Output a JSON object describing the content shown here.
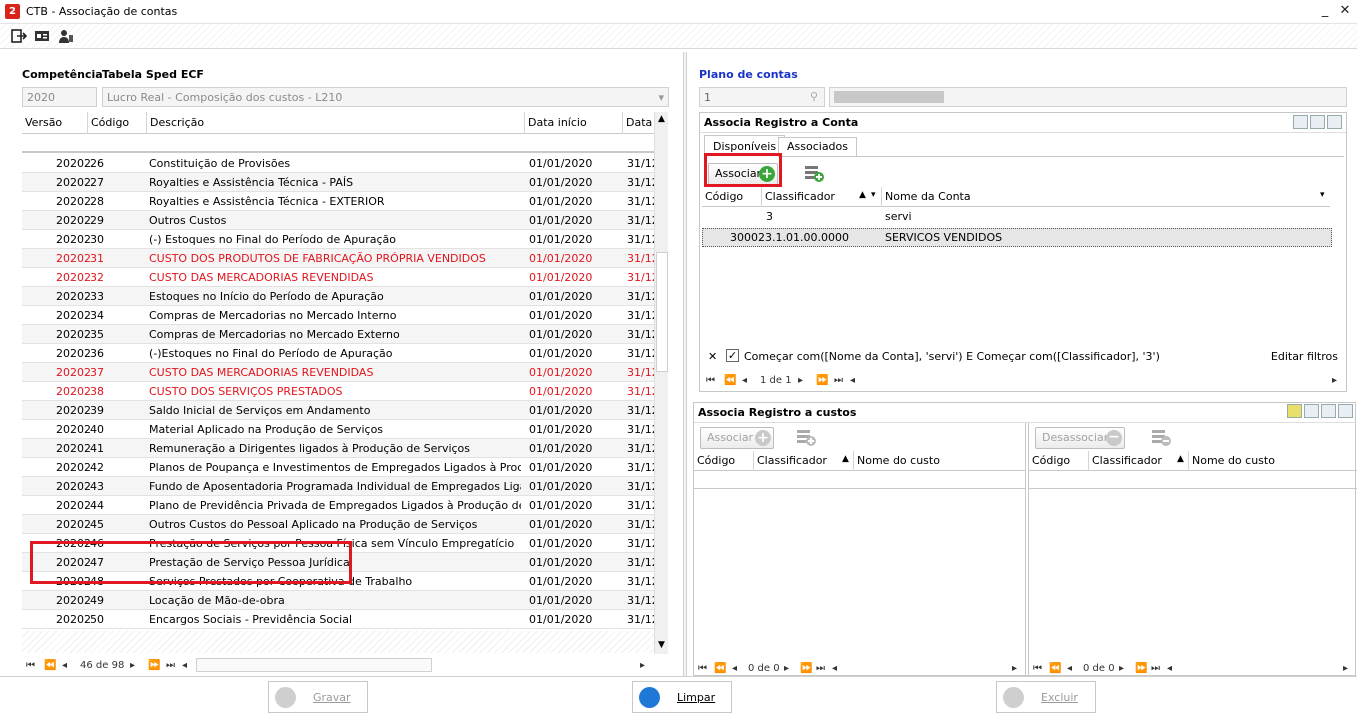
{
  "window": {
    "title": "CTB - Associação de contas",
    "minimize": "_",
    "close": "✕"
  },
  "left": {
    "competencia_label": "Competência",
    "competencia_value": "2020",
    "tabela_label": "Tabela Sped ECF",
    "tabela_value": "Lucro Real - Composição dos custos - L210",
    "columns": [
      "Versão",
      "Código",
      "Descrição",
      "Data início",
      "Data"
    ],
    "rows": [
      {
        "v": "20202",
        "c": "26",
        "d": "Constituição de Provisões",
        "di": "01/01/2020",
        "df": "31/12",
        "red": false
      },
      {
        "v": "20202",
        "c": "27",
        "d": "Royalties e Assistência Técnica - PAÍS",
        "di": "01/01/2020",
        "df": "31/12",
        "red": false
      },
      {
        "v": "20202",
        "c": "28",
        "d": "Royalties e Assistência Técnica - EXTERIOR",
        "di": "01/01/2020",
        "df": "31/12",
        "red": false
      },
      {
        "v": "20202",
        "c": "29",
        "d": "Outros Custos",
        "di": "01/01/2020",
        "df": "31/12",
        "red": false
      },
      {
        "v": "20202",
        "c": "30",
        "d": "(-) Estoques no Final do Período de Apuração",
        "di": "01/01/2020",
        "df": "31/12",
        "red": false
      },
      {
        "v": "20202",
        "c": "31",
        "d": "CUSTO DOS PRODUTOS DE FABRICAÇÃO PRÓPRIA VENDIDOS",
        "di": "01/01/2020",
        "df": "31/12",
        "red": true
      },
      {
        "v": "20202",
        "c": "32",
        "d": "CUSTO DAS MERCADORIAS REVENDIDAS",
        "di": "01/01/2020",
        "df": "31/12",
        "red": true
      },
      {
        "v": "20202",
        "c": "33",
        "d": "Estoques no Início do Período de Apuração",
        "di": "01/01/2020",
        "df": "31/12",
        "red": false
      },
      {
        "v": "20202",
        "c": "34",
        "d": "Compras de Mercadorias no Mercado Interno",
        "di": "01/01/2020",
        "df": "31/12",
        "red": false
      },
      {
        "v": "20202",
        "c": "35",
        "d": "Compras de Mercadorias no Mercado Externo",
        "di": "01/01/2020",
        "df": "31/12",
        "red": false
      },
      {
        "v": "20202",
        "c": "36",
        "d": "(-)Estoques no Final do Período de Apuração",
        "di": "01/01/2020",
        "df": "31/12",
        "red": false
      },
      {
        "v": "20202",
        "c": "37",
        "d": "CUSTO DAS MERCADORIAS REVENDIDAS",
        "di": "01/01/2020",
        "df": "31/12",
        "red": true
      },
      {
        "v": "20202",
        "c": "38",
        "d": "CUSTO DOS SERVIÇOS PRESTADOS",
        "di": "01/01/2020",
        "df": "31/12",
        "red": true
      },
      {
        "v": "20202",
        "c": "39",
        "d": "Saldo Inicial de Serviços em Andamento",
        "di": "01/01/2020",
        "df": "31/12",
        "red": false
      },
      {
        "v": "20202",
        "c": "40",
        "d": "Material Aplicado na Produção de Serviços",
        "di": "01/01/2020",
        "df": "31/12",
        "red": false
      },
      {
        "v": "20202",
        "c": "41",
        "d": "Remuneração a Dirigentes ligados à Produção de Serviços",
        "di": "01/01/2020",
        "df": "31/12",
        "red": false
      },
      {
        "v": "20202",
        "c": "42",
        "d": "Planos de Poupança e Investimentos de Empregados Ligados à Produção d...",
        "di": "01/01/2020",
        "df": "31/12",
        "red": false
      },
      {
        "v": "20202",
        "c": "43",
        "d": "Fundo de Aposentadoria Programada Individual de Empregados Ligados à P...",
        "di": "01/01/2020",
        "df": "31/12",
        "red": false
      },
      {
        "v": "20202",
        "c": "44",
        "d": "Plano de Previdência Privada de Empregados Ligados à Produção de Serviços",
        "di": "01/01/2020",
        "df": "31/12",
        "red": false
      },
      {
        "v": "20202",
        "c": "45",
        "d": "Outros Custos do Pessoal Aplicado na Produção de Serviços",
        "di": "01/01/2020",
        "df": "31/12",
        "red": false
      },
      {
        "v": "20202",
        "c": "46",
        "d": "Prestação de Serviços por Pessoa Física sem Vínculo Empregatício",
        "di": "01/01/2020",
        "df": "31/12",
        "red": false
      },
      {
        "v": "20202",
        "c": "47",
        "d": "Prestação de Serviço Pessoa Jurídica",
        "di": "01/01/2020",
        "df": "31/12",
        "red": false
      },
      {
        "v": "20202",
        "c": "48",
        "d": "Serviços Prestados por Cooperativa de Trabalho",
        "di": "01/01/2020",
        "df": "31/12",
        "red": false
      },
      {
        "v": "20202",
        "c": "49",
        "d": "Locação de Mão-de-obra",
        "di": "01/01/2020",
        "df": "31/12",
        "red": false
      },
      {
        "v": "20202",
        "c": "50",
        "d": "Encargos Sociais - Previdência Social",
        "di": "01/01/2020",
        "df": "31/12",
        "red": false
      }
    ],
    "pager": "46 de 98"
  },
  "right": {
    "plano_label": "Plano de contas",
    "plano_value": "1",
    "assoc_conta_title": "Associa Registro a Conta",
    "tabs": [
      "Disponíveis",
      "Associados"
    ],
    "associar_label": "Associar",
    "conta_columns": [
      "Código",
      "Classificador",
      "Nome da Conta"
    ],
    "filter_row": {
      "c": "",
      "cl": "3",
      "n": "servi"
    },
    "conta_rows": [
      {
        "c": "30002",
        "cl": "3.1.01.00.0000",
        "n": "SERVICOS VENDIDOS"
      }
    ],
    "filter_text": "Começar com([Nome da Conta], 'servi') E Começar com([Classificador], '3')",
    "editar_filtros": "Editar filtros",
    "conta_pager": "1 de 1",
    "assoc_custos_title": "Associa Registro a custos",
    "custos_associar": "Associar",
    "custos_desassociar": "Desassociar",
    "custos_columns": [
      "Código",
      "Classificador",
      "Nome do custo"
    ],
    "custos_pager": "0 de 0"
  },
  "footer": {
    "gravar": "Gravar",
    "limpar": "Limpar",
    "excluir": "Excluir"
  },
  "colors": {
    "red_text": "#e2141c",
    "highlight_box": "#e01822",
    "blue_label": "#1a33c8"
  }
}
